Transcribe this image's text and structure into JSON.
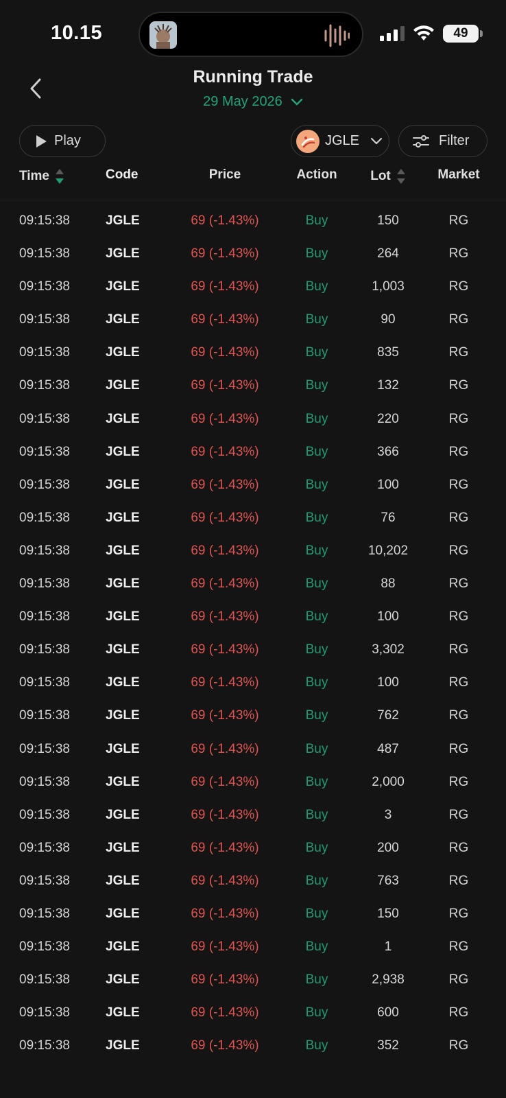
{
  "status_bar": {
    "time": "10.15",
    "battery": "49"
  },
  "header": {
    "title": "Running Trade",
    "date": "29 May 2026"
  },
  "toolbar": {
    "play_label": "Play",
    "stock_code": "JGLE",
    "filter_label": "Filter"
  },
  "table": {
    "columns": {
      "time": "Time",
      "code": "Code",
      "price": "Price",
      "action": "Action",
      "lot": "Lot",
      "market": "Market"
    },
    "rows": [
      {
        "time": "09:15:38",
        "code": "JGLE",
        "price": "69 (-1.43%)",
        "action": "Buy",
        "lot": "150",
        "market": "RG"
      },
      {
        "time": "09:15:38",
        "code": "JGLE",
        "price": "69 (-1.43%)",
        "action": "Buy",
        "lot": "264",
        "market": "RG"
      },
      {
        "time": "09:15:38",
        "code": "JGLE",
        "price": "69 (-1.43%)",
        "action": "Buy",
        "lot": "1,003",
        "market": "RG"
      },
      {
        "time": "09:15:38",
        "code": "JGLE",
        "price": "69 (-1.43%)",
        "action": "Buy",
        "lot": "90",
        "market": "RG"
      },
      {
        "time": "09:15:38",
        "code": "JGLE",
        "price": "69 (-1.43%)",
        "action": "Buy",
        "lot": "835",
        "market": "RG"
      },
      {
        "time": "09:15:38",
        "code": "JGLE",
        "price": "69 (-1.43%)",
        "action": "Buy",
        "lot": "132",
        "market": "RG"
      },
      {
        "time": "09:15:38",
        "code": "JGLE",
        "price": "69 (-1.43%)",
        "action": "Buy",
        "lot": "220",
        "market": "RG"
      },
      {
        "time": "09:15:38",
        "code": "JGLE",
        "price": "69 (-1.43%)",
        "action": "Buy",
        "lot": "366",
        "market": "RG"
      },
      {
        "time": "09:15:38",
        "code": "JGLE",
        "price": "69 (-1.43%)",
        "action": "Buy",
        "lot": "100",
        "market": "RG"
      },
      {
        "time": "09:15:38",
        "code": "JGLE",
        "price": "69 (-1.43%)",
        "action": "Buy",
        "lot": "76",
        "market": "RG"
      },
      {
        "time": "09:15:38",
        "code": "JGLE",
        "price": "69 (-1.43%)",
        "action": "Buy",
        "lot": "10,202",
        "market": "RG"
      },
      {
        "time": "09:15:38",
        "code": "JGLE",
        "price": "69 (-1.43%)",
        "action": "Buy",
        "lot": "88",
        "market": "RG"
      },
      {
        "time": "09:15:38",
        "code": "JGLE",
        "price": "69 (-1.43%)",
        "action": "Buy",
        "lot": "100",
        "market": "RG"
      },
      {
        "time": "09:15:38",
        "code": "JGLE",
        "price": "69 (-1.43%)",
        "action": "Buy",
        "lot": "3,302",
        "market": "RG"
      },
      {
        "time": "09:15:38",
        "code": "JGLE",
        "price": "69 (-1.43%)",
        "action": "Buy",
        "lot": "100",
        "market": "RG"
      },
      {
        "time": "09:15:38",
        "code": "JGLE",
        "price": "69 (-1.43%)",
        "action": "Buy",
        "lot": "762",
        "market": "RG"
      },
      {
        "time": "09:15:38",
        "code": "JGLE",
        "price": "69 (-1.43%)",
        "action": "Buy",
        "lot": "487",
        "market": "RG"
      },
      {
        "time": "09:15:38",
        "code": "JGLE",
        "price": "69 (-1.43%)",
        "action": "Buy",
        "lot": "2,000",
        "market": "RG"
      },
      {
        "time": "09:15:38",
        "code": "JGLE",
        "price": "69 (-1.43%)",
        "action": "Buy",
        "lot": "3",
        "market": "RG"
      },
      {
        "time": "09:15:38",
        "code": "JGLE",
        "price": "69 (-1.43%)",
        "action": "Buy",
        "lot": "200",
        "market": "RG"
      },
      {
        "time": "09:15:38",
        "code": "JGLE",
        "price": "69 (-1.43%)",
        "action": "Buy",
        "lot": "763",
        "market": "RG"
      },
      {
        "time": "09:15:38",
        "code": "JGLE",
        "price": "69 (-1.43%)",
        "action": "Buy",
        "lot": "150",
        "market": "RG"
      },
      {
        "time": "09:15:38",
        "code": "JGLE",
        "price": "69 (-1.43%)",
        "action": "Buy",
        "lot": "1",
        "market": "RG"
      },
      {
        "time": "09:15:38",
        "code": "JGLE",
        "price": "69 (-1.43%)",
        "action": "Buy",
        "lot": "2,938",
        "market": "RG"
      },
      {
        "time": "09:15:38",
        "code": "JGLE",
        "price": "69 (-1.43%)",
        "action": "Buy",
        "lot": "600",
        "market": "RG"
      },
      {
        "time": "09:15:38",
        "code": "JGLE",
        "price": "69 (-1.43%)",
        "action": "Buy",
        "lot": "352",
        "market": "RG"
      }
    ]
  },
  "colors": {
    "background": "#141414",
    "accent_green": "#239c74",
    "price_red": "#e05552"
  },
  "icons": [
    "back-chevron-icon",
    "chevron-down-icon",
    "play-icon",
    "stock-logo-icon",
    "filter-sliders-icon",
    "sort-icon",
    "signal-icon",
    "wifi-icon",
    "battery-icon"
  ]
}
